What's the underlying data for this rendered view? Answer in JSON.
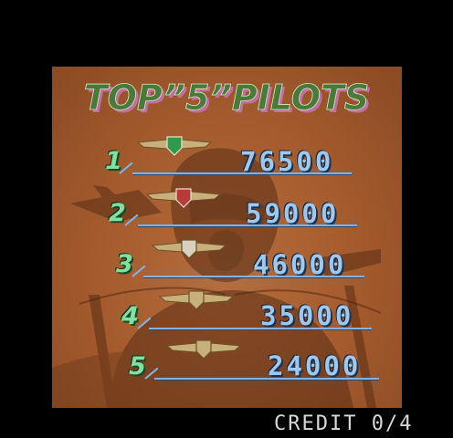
{
  "title": "TOP”5”PILOTS",
  "title_color": "#4a7a3a",
  "title_shadow": "#c26ea0",
  "rows": [
    {
      "rank": "1",
      "score": "76500",
      "badge_color": "#2f9a4a"
    },
    {
      "rank": "2",
      "score": "59000",
      "badge_color": "#b83a3a"
    },
    {
      "rank": "3",
      "score": "46000",
      "badge_color": "#d8d0c0"
    },
    {
      "rank": "4",
      "score": "35000",
      "badge_color": "#c9b07a"
    },
    {
      "rank": "5",
      "score": "24000",
      "badge_color": "#c9b07a"
    }
  ],
  "credit": "CREDIT 0/4",
  "rank_color": "#7fe0a0",
  "score_color": "#9ec8ee",
  "background_color": "#a35a2c"
}
